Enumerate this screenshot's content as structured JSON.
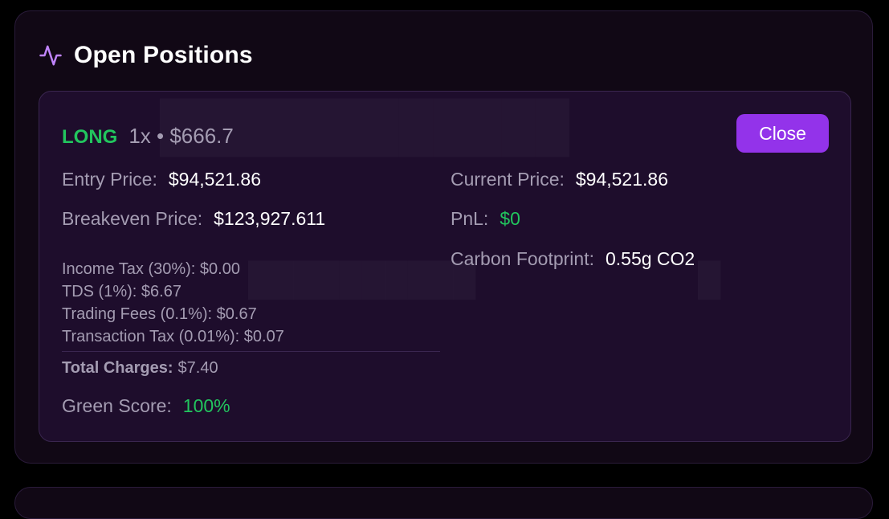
{
  "section": {
    "title": "Open Positions",
    "icon": "activity-pulse-icon"
  },
  "position": {
    "side": "LONG",
    "leverage_amount": "1x • $666.7",
    "close_label": "Close",
    "entry_label": "Entry Price:",
    "entry_value": "$94,521.86",
    "current_label": "Current Price:",
    "current_value": "$94,521.86",
    "breakeven_label": "Breakeven Price:",
    "breakeven_value": "$123,927.611",
    "pnl_label": "PnL:",
    "pnl_value": "$0",
    "carbon_label": "Carbon Footprint:",
    "carbon_value": "0.55g CO2",
    "charges": [
      "Income Tax (30%): $0.00",
      "TDS (1%): $6.67",
      "Trading Fees (0.1%): $0.67",
      "Transaction Tax (0.01%): $0.07"
    ],
    "total_charges_label": "Total Charges:",
    "total_charges_value": "$7.40",
    "green_score_label": "Green Score:",
    "green_score_value": "100%"
  },
  "colors": {
    "accent": "#9333ea",
    "positive": "#22c55e",
    "muted_text": "#a49cb2",
    "card_bg": "#1e0d2c",
    "panel_bg": "#110815"
  }
}
